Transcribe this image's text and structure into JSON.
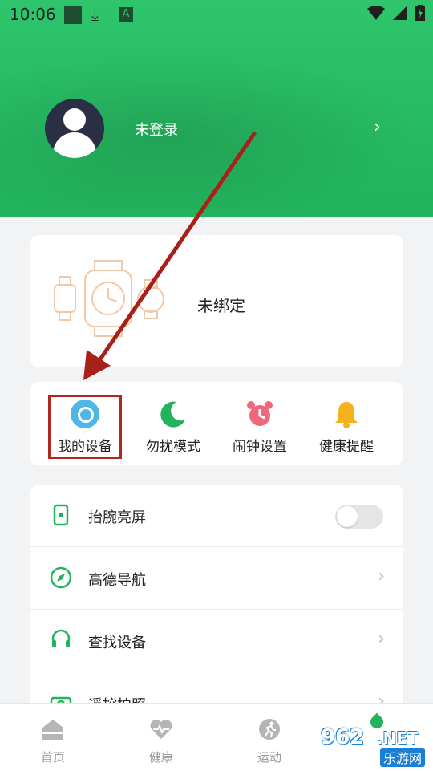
{
  "status_bar": {
    "time": "10:06"
  },
  "profile": {
    "name": "未登录"
  },
  "device_card": {
    "status": "未绑定"
  },
  "quick_actions": [
    {
      "label": "我的设备",
      "icon": "device-icon",
      "color": "#4fb7e6"
    },
    {
      "label": "勿扰模式",
      "icon": "moon-icon",
      "color": "#22b35c"
    },
    {
      "label": "闹钟设置",
      "icon": "alarm-clock-icon",
      "color": "#f0697a"
    },
    {
      "label": "健康提醒",
      "icon": "bell-icon",
      "color": "#f5b21c"
    }
  ],
  "settings": [
    {
      "label": "抬腕亮屏",
      "icon": "wrist-screen-icon",
      "control": "toggle",
      "on": false
    },
    {
      "label": "高德导航",
      "icon": "compass-icon",
      "control": "chevron"
    },
    {
      "label": "查找设备",
      "icon": "find-device-icon",
      "control": "chevron"
    },
    {
      "label": "遥控拍照",
      "icon": "camera-icon",
      "control": "chevron"
    }
  ],
  "bottom_nav": [
    {
      "label": "首页",
      "icon": "home-icon"
    },
    {
      "label": "健康",
      "icon": "heart-pulse-icon"
    },
    {
      "label": "运动",
      "icon": "running-icon"
    }
  ],
  "watermark": {
    "number": "962",
    "suffix": ".NET",
    "site": "乐游网"
  },
  "colors": {
    "primary": "#22b35c",
    "highlight": "#b3261e"
  }
}
